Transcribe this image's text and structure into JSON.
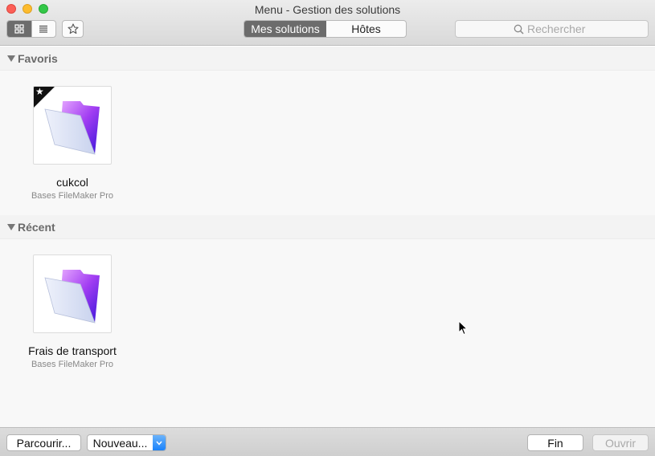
{
  "window": {
    "title": "Menu - Gestion des solutions"
  },
  "toolbar": {
    "tabs": [
      {
        "label": "Mes solutions",
        "active": true
      },
      {
        "label": "Hôtes",
        "active": false
      }
    ],
    "search": {
      "placeholder": "Rechercher",
      "value": ""
    },
    "view_mode": "grid"
  },
  "sections": [
    {
      "title": "Favoris",
      "items": [
        {
          "name": "cukcol",
          "subtitle": "Bases FileMaker Pro",
          "favorite": true
        }
      ]
    },
    {
      "title": "Récent",
      "items": [
        {
          "name": "Frais de transport",
          "subtitle": "Bases FileMaker Pro",
          "favorite": false
        }
      ]
    }
  ],
  "footer": {
    "browse_label": "Parcourir...",
    "new_label": "Nouveau...",
    "done_label": "Fin",
    "open_label": "Ouvrir"
  },
  "colors": {
    "active_segment": "#6c6c6c",
    "dropdown_accent": "#1a82fb",
    "icon_purple": "#9b3cf0"
  },
  "icons": {
    "grid_view": "grid-view-icon",
    "list_view": "list-view-icon",
    "favorites": "star-icon",
    "search": "search-icon",
    "solution": "filemaker-folder-icon"
  }
}
